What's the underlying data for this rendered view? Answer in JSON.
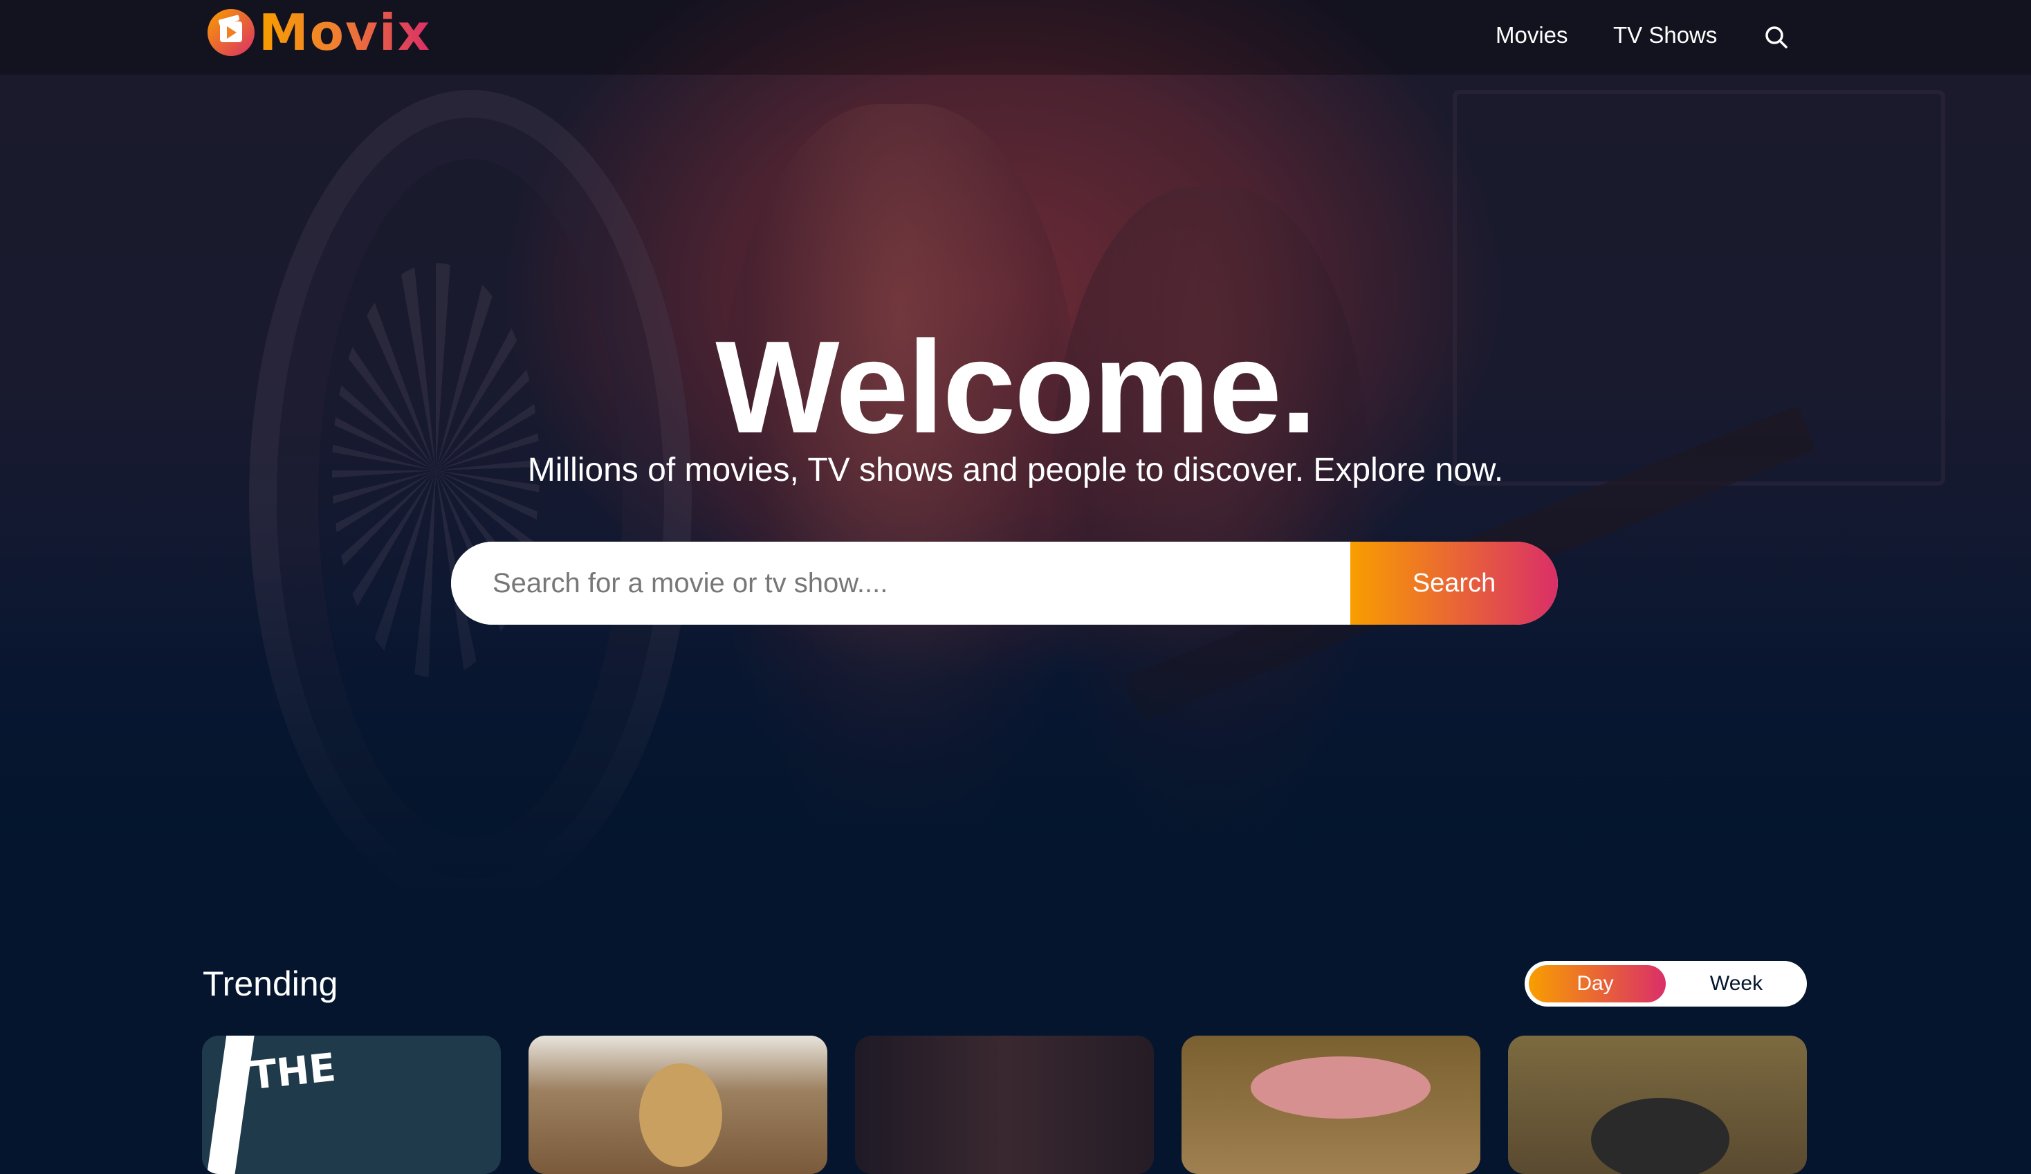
{
  "header": {
    "logo_text": "Movix",
    "nav": [
      {
        "label": "Movies"
      },
      {
        "label": "TV Shows"
      }
    ]
  },
  "hero": {
    "title": "Welcome.",
    "subtitle": "Millions of movies, TV shows and people to discover. Explore now.",
    "search": {
      "placeholder": "Search for a movie or tv show....",
      "value": "",
      "button_label": "Search"
    }
  },
  "trending": {
    "title": "Trending",
    "tabs": [
      {
        "label": "Day",
        "active": true
      },
      {
        "label": "Week",
        "active": false
      }
    ],
    "card_1_text": "THE"
  },
  "colors": {
    "background": "#04152d",
    "gradient_start": "#f89e00",
    "gradient_end": "#da2f68"
  },
  "icons": {
    "search": "search-icon",
    "logo": "clapperboard-play-icon"
  }
}
